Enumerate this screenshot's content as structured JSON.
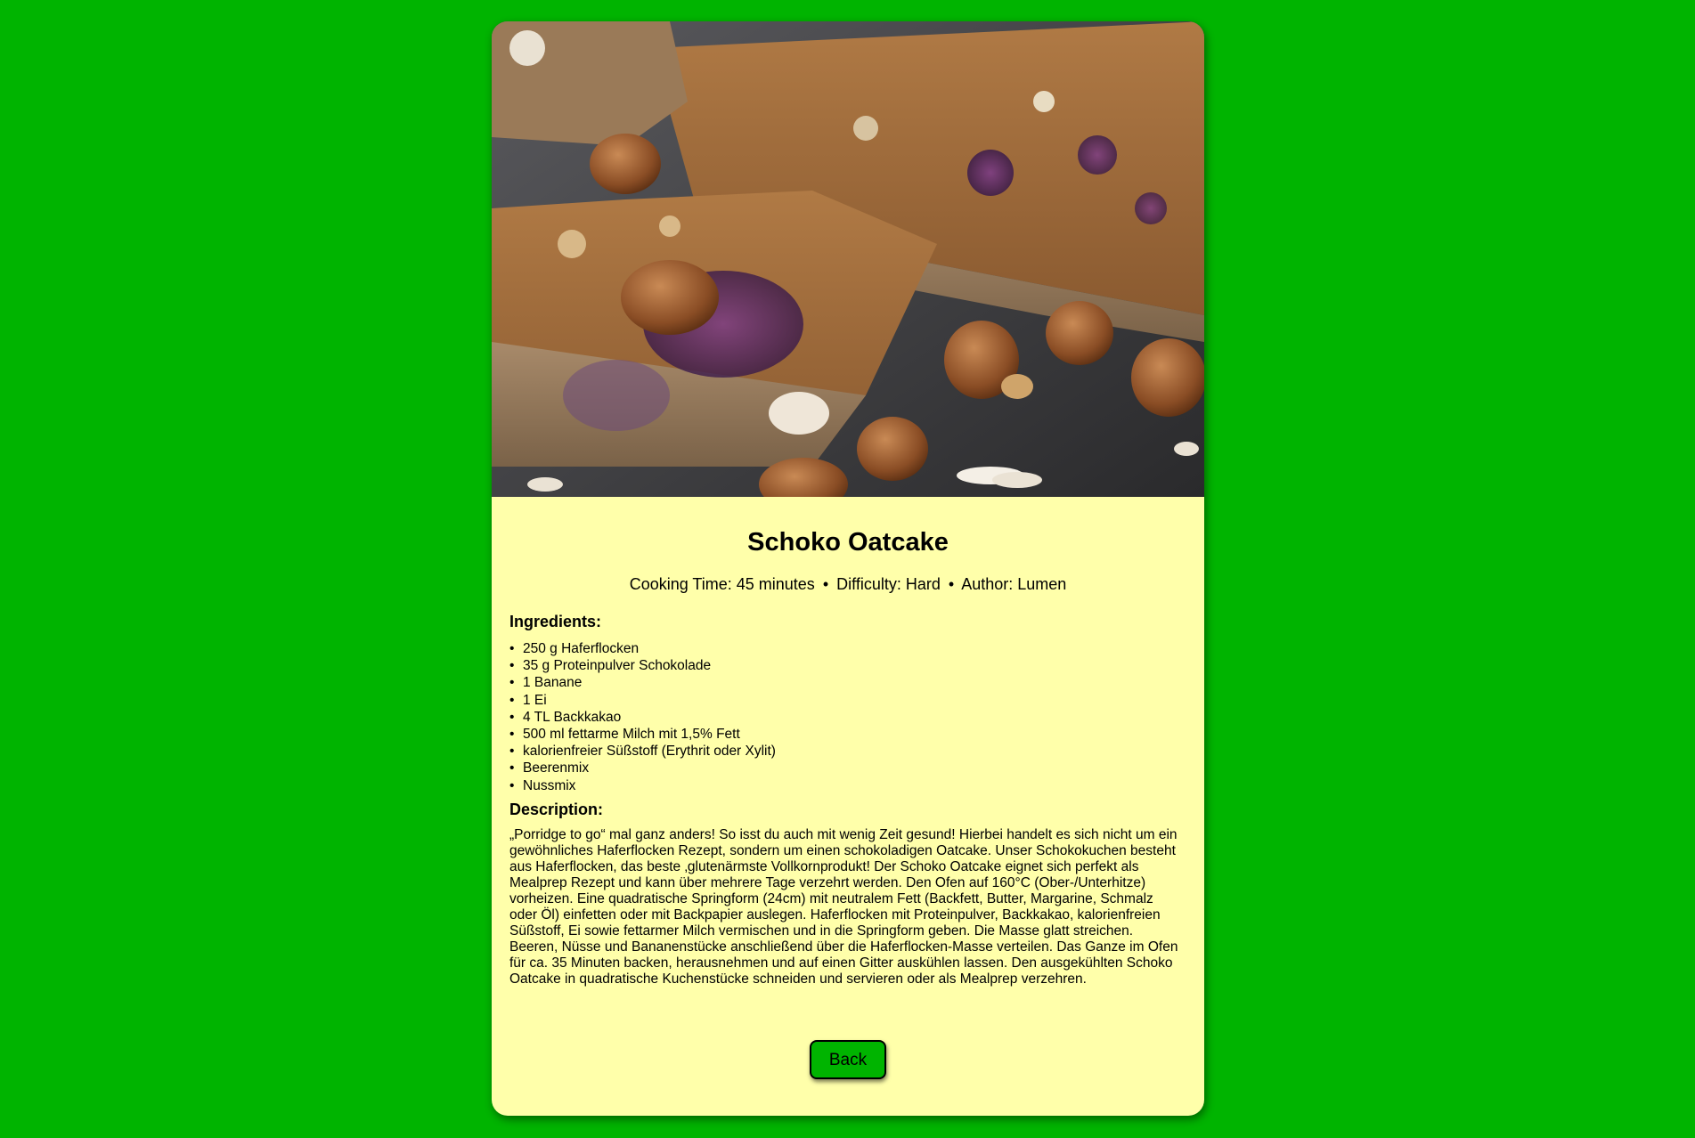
{
  "recipe": {
    "title": "Schoko Oatcake",
    "meta": {
      "cooking_time": "Cooking Time: 45 minutes",
      "separator": "•",
      "difficulty": "Difficulty: Hard",
      "author": "Author: Lumen"
    },
    "ingredients_heading": "Ingredients:",
    "ingredients": [
      "250 g Haferflocken",
      "35 g Proteinpulver Schokolade",
      "1 Banane",
      "1 Ei",
      "4 TL Backkakao",
      "500 ml fettarme Milch mit 1,5% Fett",
      "kalorienfreier Süßstoff (Erythrit oder Xylit)",
      "Beerenmix",
      "Nussmix"
    ],
    "bullet": "•",
    "description_heading": "Description:",
    "description": "„Porridge to go“ mal ganz anders! So isst du auch mit wenig Zeit gesund! Hierbei handelt es sich nicht um ein gewöhnliches Haferflocken Rezept, sondern um einen schokoladigen Oatcake. Unser Schokokuchen besteht aus Haferflocken, das beste ‚glutenärmste Vollkornprodukt! Der Schoko Oatcake eignet sich perfekt als Mealprep Rezept und kann über mehrere Tage verzehrt werden. Den Ofen auf 160°C (Ober-/Unterhitze) vorheizen. Eine quadratische Springform (24cm) mit neutralem Fett (Backfett, Butter, Margarine, Schmalz oder Öl) einfetten oder mit Backpapier auslegen. Haferflocken mit Proteinpulver, Backkakao, kalorienfreien Süßstoff, Ei sowie fettarmer Milch vermischen und in die Springform geben. Die Masse glatt streichen. Beeren, Nüsse und Bananenstücke anschließend über die Haferflocken-Masse verteilen. Das Ganze im Ofen für ca. 35 Minuten backen, herausnehmen und auf einen Gitter auskühlen lassen. Den ausgekühlten Schoko Oatcake in quadratische Kuchenstücke schneiden und servieren oder als Mealprep verzehren."
  },
  "actions": {
    "back_label": "Back"
  },
  "colors": {
    "page_background": "#00b400",
    "card_background": "#ffffaa",
    "button_background": "#00b400"
  }
}
